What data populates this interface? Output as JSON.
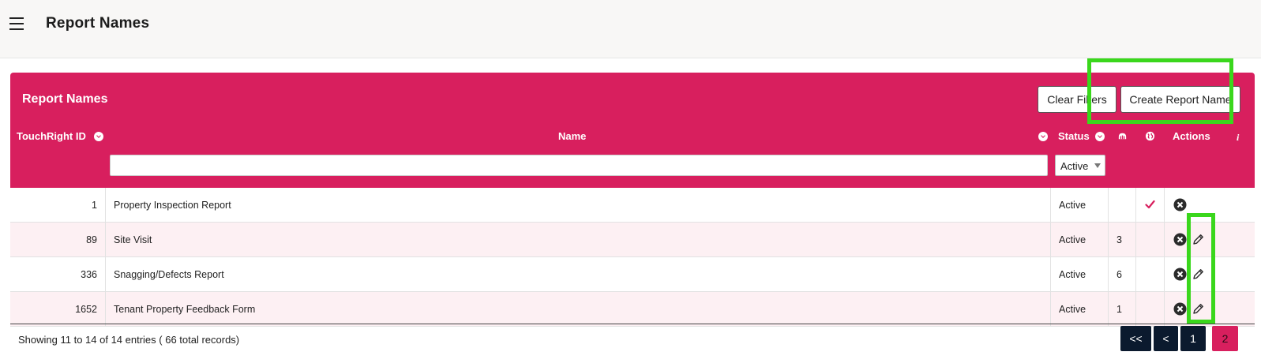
{
  "topbar": {
    "title": "Report Names"
  },
  "card": {
    "title": "Report Names",
    "clear_filters_label": "Clear Filters",
    "create_label": "Create Report Name",
    "accent_color": "#d81f5e"
  },
  "columns": {
    "id": "TouchRight ID",
    "name": "Name",
    "status": "Status",
    "actions": "Actions"
  },
  "filters": {
    "name_value": "",
    "status_selected": "Active"
  },
  "rows": [
    {
      "id": "1",
      "name": "Property Inspection Report",
      "status": "Active",
      "count": "",
      "global": true,
      "editable": false
    },
    {
      "id": "89",
      "name": "Site Visit",
      "status": "Active",
      "count": "3",
      "global": false,
      "editable": true
    },
    {
      "id": "336",
      "name": "Snagging/Defects Report",
      "status": "Active",
      "count": "6",
      "global": false,
      "editable": true
    },
    {
      "id": "1652",
      "name": "Tenant Property Feedback Form",
      "status": "Active",
      "count": "1",
      "global": false,
      "editable": true
    }
  ],
  "footer": {
    "summary": "Showing 11 to 14 of 14 entries ( 66 total records)"
  },
  "pagination": {
    "first": "<<",
    "prev": "<",
    "page1": "1",
    "page2": "2"
  },
  "icons": {
    "menu": "hamburger-icon",
    "sort": "chevron-down-circle-icon",
    "count_header": "cloud-icon",
    "global_header": "globe-icon",
    "info": "info-icon",
    "delete": "close-circle-icon",
    "edit": "pencil-icon",
    "global": "check-icon"
  },
  "highlight_color": "#3ad71c"
}
